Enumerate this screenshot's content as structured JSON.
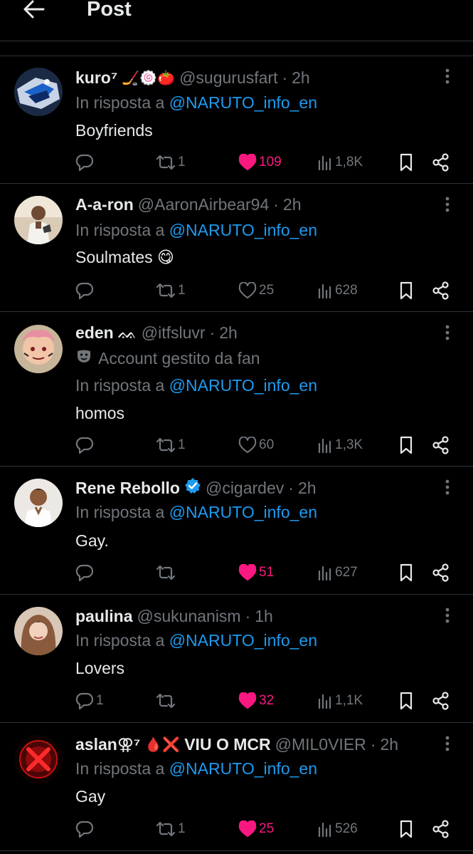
{
  "header": {
    "title": "Post",
    "back_icon": "arrow-left-icon"
  },
  "reply_prefix": "In risposta a",
  "tweets": [
    {
      "name": "kuro⁷",
      "name_emoji": "🏒🍥🍅",
      "handle": "@sugurusfart",
      "dot": "·",
      "time": "2h",
      "reply_to": "@NARUTO_info_en",
      "text": "Boyfriends",
      "replies": "",
      "reposts": "1",
      "likes": "109",
      "liked": true,
      "views": "1,8K"
    },
    {
      "name": "A-a-ron",
      "handle": "@AaronAirbear94",
      "dot": "·",
      "time": "2h",
      "reply_to": "@NARUTO_info_en",
      "text": "Soulmates 😋",
      "replies": "",
      "reposts": "1",
      "likes": "25",
      "liked": false,
      "views": "628"
    },
    {
      "name": "eden",
      "name_emoji": "ᨐ",
      "handle": "@itfsluvr",
      "dot": "·",
      "time": "2h",
      "fan_label": "Account gestito da fan",
      "reply_to": "@NARUTO_info_en",
      "text": "homos",
      "replies": "",
      "reposts": "1",
      "likes": "60",
      "liked": false,
      "views": "1,3K"
    },
    {
      "name": "Rene Rebollo",
      "verified": true,
      "handle": "@cigardev",
      "dot": "·",
      "time": "2h",
      "reply_to": "@NARUTO_info_en",
      "text": "Gay.",
      "replies": "",
      "reposts": "",
      "likes": "51",
      "liked": true,
      "views": "627"
    },
    {
      "name": "paulina",
      "handle": "@sukunanism",
      "dot": "·",
      "time": "1h",
      "reply_to": "@NARUTO_info_en",
      "text": "Lovers",
      "replies": "1",
      "reposts": "",
      "likes": "32",
      "liked": true,
      "views": "1,1K"
    },
    {
      "name": "aslan⚢⁷",
      "name_emoji": "🩸❌",
      "name_suffix": "VIU O MCR",
      "handle": "@MIL0VIER",
      "dot": "·",
      "time": "2h",
      "reply_to": "@NARUTO_info_en",
      "text": "Gay",
      "replies": "",
      "reposts": "1",
      "likes": "25",
      "liked": true,
      "views": "526"
    }
  ],
  "colors": {
    "background": "#000000",
    "text": "#e7e9ea",
    "muted": "#71767b",
    "link": "#1d9bf0",
    "like": "#f91880",
    "divider": "#2f3336"
  }
}
